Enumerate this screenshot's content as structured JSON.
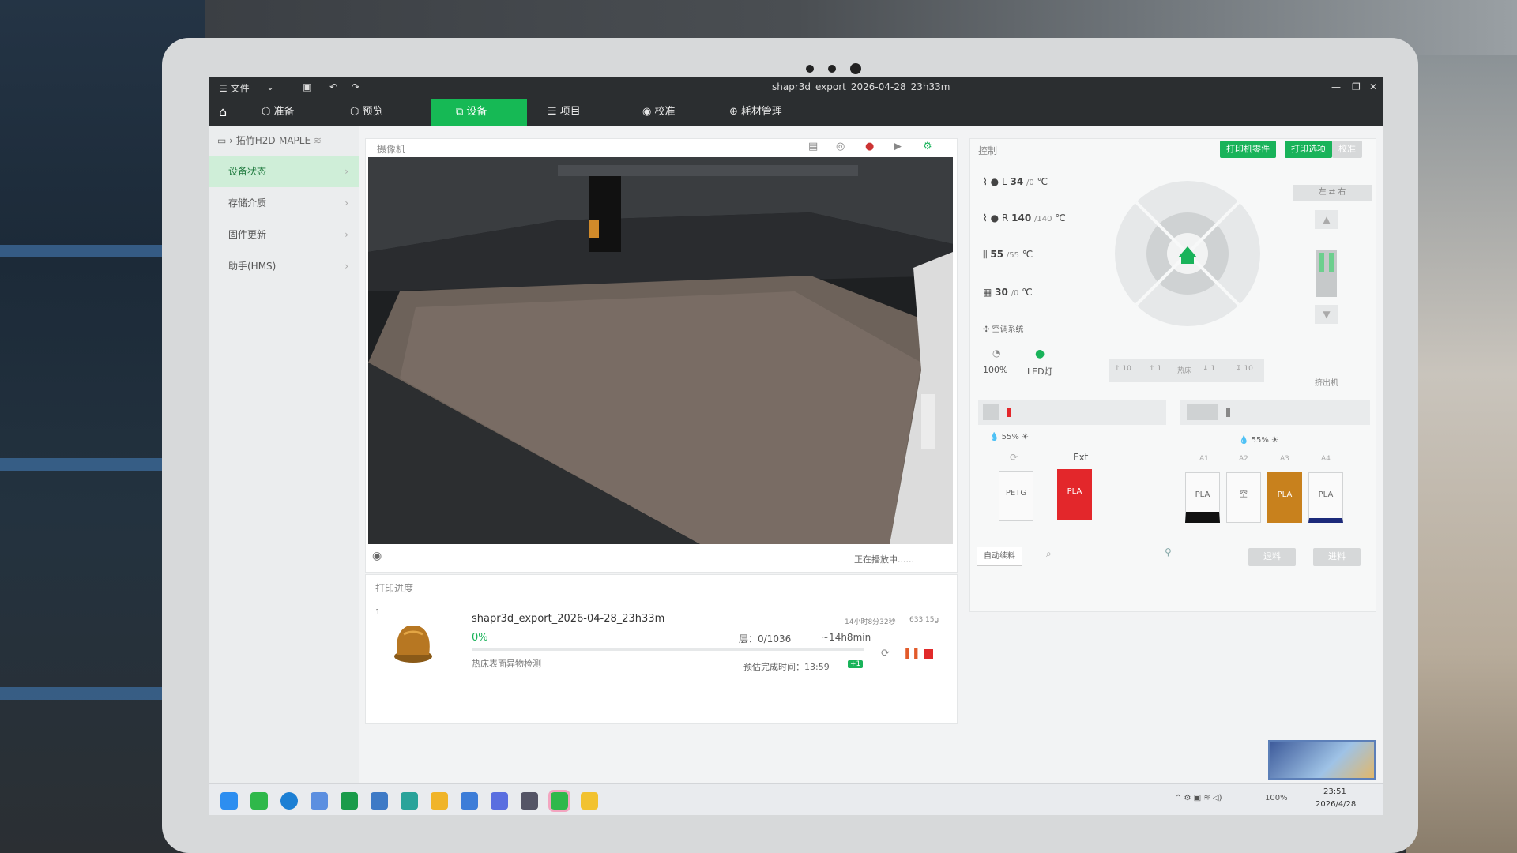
{
  "window": {
    "title": "shapr3d_export_2026-04-28_23h33m",
    "menu_file": "☰ 文件"
  },
  "tabs": [
    "准备",
    "预览",
    "设备",
    "项目",
    "校准",
    "耗材管理"
  ],
  "device": {
    "name": "拓竹H2D-MAPLE"
  },
  "sidebar": {
    "items": [
      "设备状态",
      "存储介质",
      "固件更新",
      "助手(HMS)"
    ]
  },
  "camera": {
    "title": "摄像机",
    "status": "正在播放中......"
  },
  "progress": {
    "title": "打印进度",
    "index": "1",
    "filename": "shapr3d_export_2026-04-28_23h33m",
    "time_info": "14小时8分32秒",
    "weight": "633.15g",
    "percent_text": "0%",
    "percent": 0,
    "layer": "层：0/1036",
    "remaining": "~14h8min",
    "stage": "热床表面异物检测",
    "eta": "预估完成时间：13:59",
    "plus_badge": "+1"
  },
  "control": {
    "title": "控制",
    "btn_parts": "打印机零件",
    "btn_options": "打印选项",
    "btn_calib": "校准",
    "temps": [
      {
        "label": "L",
        "value": "34",
        "target": "/0",
        "unit": "℃"
      },
      {
        "label": "R",
        "value": "140",
        "target": "/140",
        "unit": "℃"
      },
      {
        "label": "",
        "value": "55",
        "target": "/55",
        "unit": "℃"
      },
      {
        "label": "",
        "value": "30",
        "target": "/0",
        "unit": "℃"
      }
    ],
    "aircon": "空调系统",
    "fan_pct": "100%",
    "led": "LED灯",
    "left_right": [
      "左",
      "右"
    ],
    "bed_label": "热床",
    "bed_steps": [
      "10",
      "1",
      "1",
      "10"
    ],
    "extruder_label": "挤出机",
    "humidity_left": "55%",
    "humidity_right": "55%",
    "ext_label": "Ext",
    "spools_left": [
      "PETG",
      "PLA"
    ],
    "ams_slots": [
      "A1",
      "A2",
      "A3",
      "A4"
    ],
    "spools_right": [
      "PLA",
      "空",
      "PLA",
      "PLA"
    ],
    "auto_refill": "自动续料",
    "retract": "退料",
    "feed": "进料"
  },
  "taskbar": {
    "battery": "100%",
    "time": "23:51",
    "date": "2026/4/28"
  },
  "colors": {
    "accent": "#16b955",
    "ext_red": "#e3272b",
    "orange": "#c8811d",
    "navy": "#1c2a7a"
  }
}
